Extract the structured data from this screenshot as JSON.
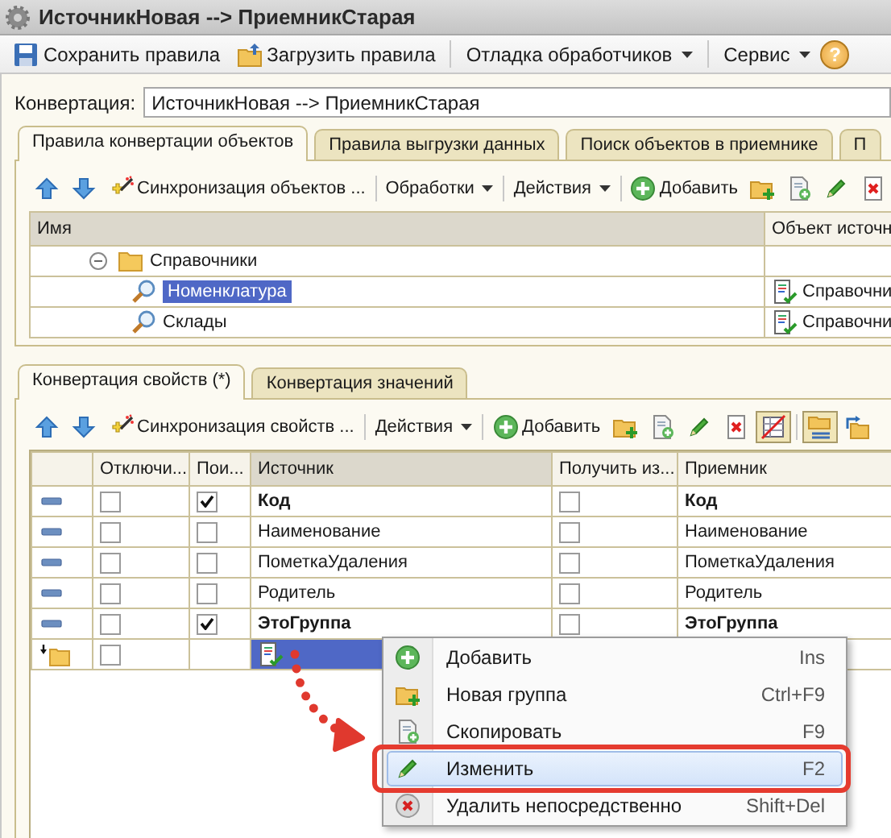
{
  "window": {
    "title": "ИсточникНовая --> ПриемникСтарая"
  },
  "toolbar": [
    {
      "kind": "save",
      "label": "Сохранить правила"
    },
    {
      "kind": "load",
      "label": "Загрузить правила"
    },
    {
      "kind": "separator"
    },
    {
      "kind": "menu",
      "label": "Отладка обработчиков"
    },
    {
      "kind": "separator"
    },
    {
      "kind": "menu",
      "label": "Сервис"
    },
    {
      "kind": "help",
      "label": "?"
    }
  ],
  "conversion": {
    "label": "Конвертация:",
    "value": "ИсточникНовая --> ПриемникСтарая"
  },
  "tabs": [
    {
      "label": "Правила конвертации объектов",
      "selected": true
    },
    {
      "label": "Правила выгрузки данных",
      "selected": false
    },
    {
      "label": "Поиск объектов в приемнике",
      "selected": false
    },
    {
      "label": "П",
      "selected": false
    }
  ],
  "rules_toolbar": [
    {
      "kind": "up"
    },
    {
      "kind": "down"
    },
    {
      "kind": "sync",
      "label": "Синхронизация объектов ..."
    },
    {
      "kind": "separator"
    },
    {
      "kind": "menu",
      "label": "Обработки"
    },
    {
      "kind": "separator"
    },
    {
      "kind": "menu",
      "label": "Действия"
    },
    {
      "kind": "separator"
    },
    {
      "kind": "add",
      "label": "Добавить"
    },
    {
      "kind": "new-folder"
    },
    {
      "kind": "copy"
    },
    {
      "kind": "edit"
    },
    {
      "kind": "delete"
    }
  ],
  "rules_table": {
    "columns": [
      "Имя",
      "Объект источн"
    ],
    "rows": [
      {
        "label": "Справочники",
        "expanded": true,
        "selected": false,
        "children": [
          {
            "label": "Номенклатура",
            "selected": true,
            "source": "Справочни"
          },
          {
            "label": "Склады",
            "selected": false,
            "source": "Справочни"
          }
        ]
      }
    ]
  },
  "property_tabs": [
    {
      "label": "Конвертация свойств (*)",
      "selected": true
    },
    {
      "label": "Конвертация значений",
      "selected": false
    }
  ],
  "properties_toolbar": [
    {
      "kind": "up"
    },
    {
      "kind": "down"
    },
    {
      "kind": "sync",
      "label": "Синхронизация свойств ..."
    },
    {
      "kind": "separator"
    },
    {
      "kind": "menu",
      "label": "Действия"
    },
    {
      "kind": "separator"
    },
    {
      "kind": "add",
      "label": "Добавить"
    },
    {
      "kind": "new-folder"
    },
    {
      "kind": "copy"
    },
    {
      "kind": "edit"
    },
    {
      "kind": "delete"
    },
    {
      "kind": "map-toggle",
      "pressed": true
    },
    {
      "kind": "separator"
    },
    {
      "kind": "group-toggle",
      "pressed": true
    },
    {
      "kind": "return"
    }
  ],
  "properties_table": {
    "columns": [
      "Отключи...",
      "Пои...",
      "Источник",
      "Получить из...",
      "Приемник"
    ],
    "rows": [
      {
        "kind": "property",
        "off": false,
        "search": true,
        "source": "Код",
        "get_from": false,
        "target": "Код",
        "key": true,
        "selected": false
      },
      {
        "kind": "property",
        "off": false,
        "search": false,
        "source": "Наименование",
        "get_from": false,
        "target": "Наименование",
        "key": false,
        "selected": false
      },
      {
        "kind": "property",
        "off": false,
        "search": false,
        "source": "ПометкаУдаления",
        "get_from": false,
        "target": "ПометкаУдаления",
        "key": false,
        "selected": false
      },
      {
        "kind": "property",
        "off": false,
        "search": false,
        "source": "Родитель",
        "get_from": false,
        "target": "Родитель",
        "key": false,
        "selected": false
      },
      {
        "kind": "property",
        "off": false,
        "search": true,
        "source": "ЭтоГруппа",
        "get_from": false,
        "target": "ЭтоГруппа",
        "key": true,
        "selected": false
      },
      {
        "kind": "group",
        "off": false,
        "selected": true
      }
    ]
  },
  "context_menu": {
    "pointer_arrow": true,
    "items": [
      {
        "kind": "add",
        "label": "Добавить",
        "shortcut": "Ins",
        "highlighted": false
      },
      {
        "kind": "new-folder",
        "label": "Новая группа",
        "shortcut": "Ctrl+F9",
        "highlighted": false
      },
      {
        "kind": "copy",
        "label": "Скопировать",
        "shortcut": "F9",
        "highlighted": false
      },
      {
        "kind": "edit",
        "label": "Изменить",
        "shortcut": "F2",
        "highlighted": true
      },
      {
        "kind": "remove",
        "label": "Удалить непосредственно",
        "shortcut": "Shift+Del",
        "highlighted": false
      }
    ]
  }
}
